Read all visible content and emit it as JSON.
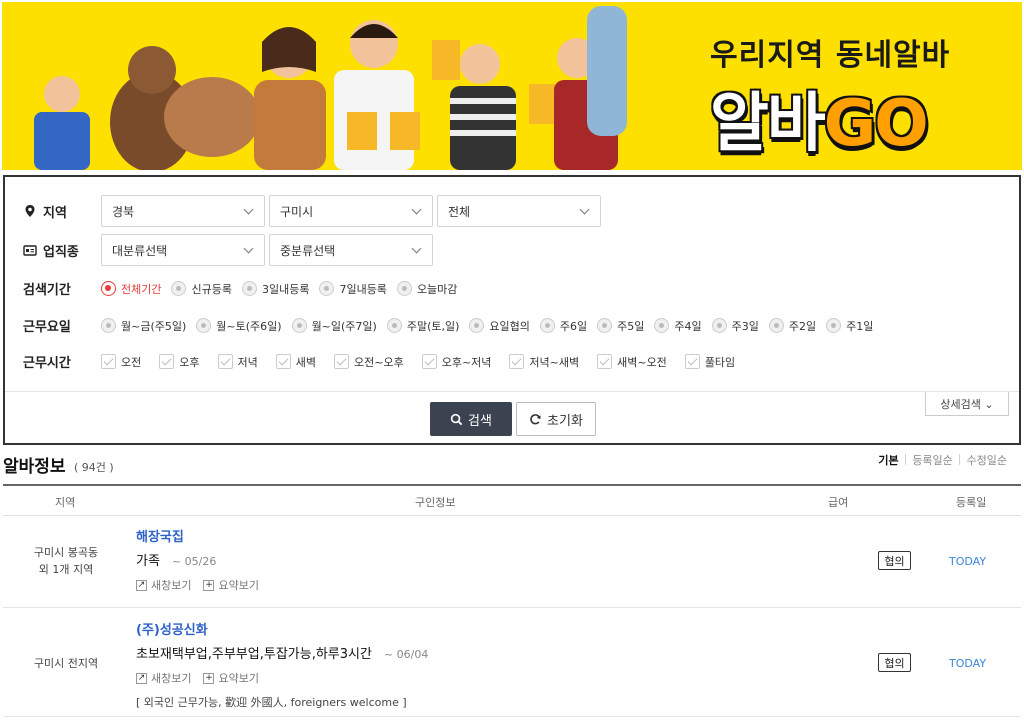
{
  "banner": {
    "title": "우리지역 동네알바",
    "logo_a": "알바",
    "logo_b": "GO"
  },
  "filters": {
    "region": {
      "label": "지역",
      "province": "경북",
      "city": "구미시",
      "district": "전체"
    },
    "job": {
      "label": "업직종",
      "major": "대분류선택",
      "minor": "중분류선택"
    },
    "period": {
      "label": "검색기간",
      "options": [
        "전체기간",
        "신규등록",
        "3일내등록",
        "7일내등록",
        "오늘마감"
      ],
      "selected": 0
    },
    "days": {
      "label": "근무요일",
      "options": [
        "월~금(주5일)",
        "월~토(주6일)",
        "월~일(주7일)",
        "주말(토,일)",
        "요일협의",
        "주6일",
        "주5일",
        "주4일",
        "주3일",
        "주2일",
        "주1일"
      ]
    },
    "hours": {
      "label": "근무시간",
      "options": [
        "오전",
        "오후",
        "저녁",
        "새벽",
        "오전~오후",
        "오후~저녁",
        "저녁~새벽",
        "새벽~오전",
        "풀타임"
      ]
    },
    "detail_label": "상세검색 ⌄",
    "search_label": "검색",
    "reset_label": "초기화"
  },
  "results": {
    "title": "알바정보",
    "count": "( 94건 )",
    "sort": [
      "기본",
      "등록일순",
      "수정일순"
    ],
    "columns": [
      "지역",
      "구인정보",
      "급여",
      "등록일"
    ],
    "rows": [
      {
        "region_1": "구미시 봉곡동",
        "region_2": "외 1개 지역",
        "company": "해장국집",
        "title": "가족",
        "deadline": "~ 05/26",
        "view_new": "새창보기",
        "view_summary": "요약보기",
        "pay": "협의",
        "date": "TODAY",
        "note": ""
      },
      {
        "region_1": "구미시 전지역",
        "region_2": "",
        "company": "(주)성공신화",
        "title": "초보재택부업,주부부업,투잡가능,하루3시간",
        "deadline": "~ 06/04",
        "view_new": "새창보기",
        "view_summary": "요약보기",
        "pay": "협의",
        "date": "TODAY",
        "note": "[ 외국인 근무가능, 歡迎 外國人, foreigners welcome ]"
      }
    ]
  }
}
